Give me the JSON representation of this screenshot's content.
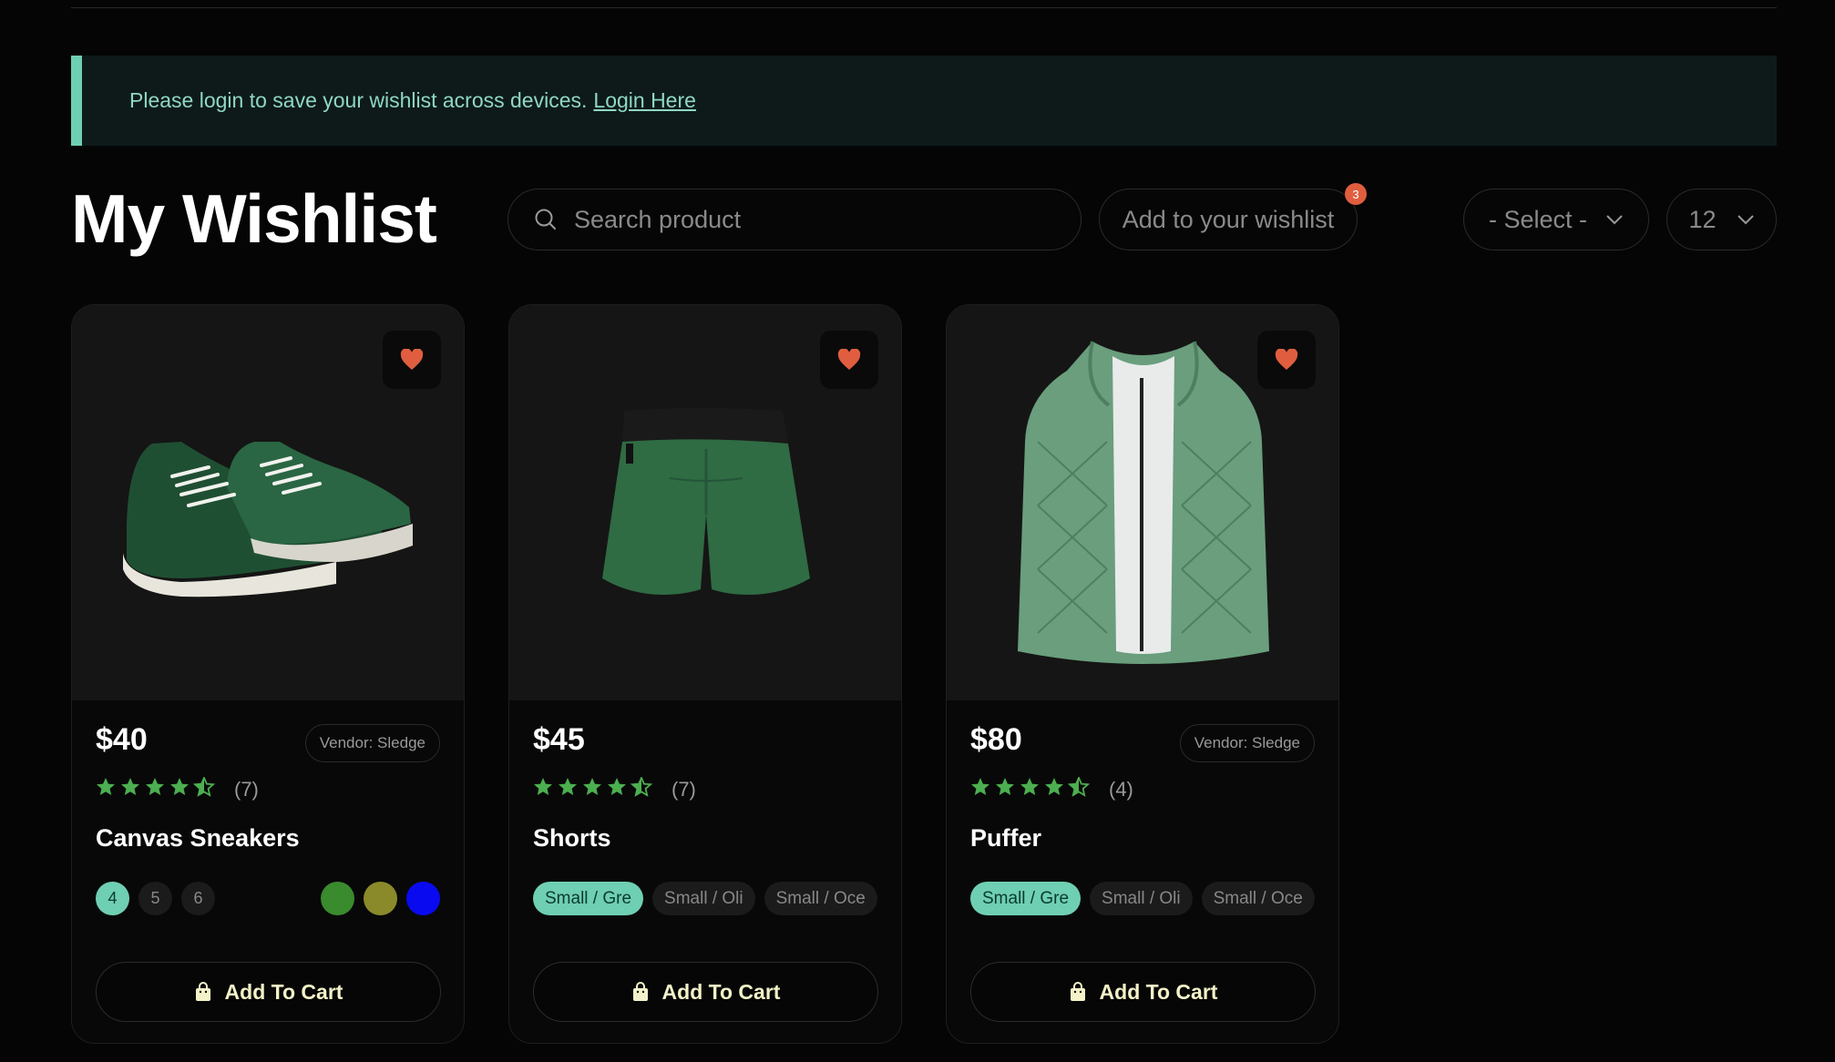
{
  "notice": {
    "text": "Please login to save your wishlist across devices.",
    "link": "Login Here"
  },
  "page_title": "My Wishlist",
  "search": {
    "placeholder": "Search product"
  },
  "add_wishlist": {
    "label": "Add to your wishlist",
    "badge": "3"
  },
  "sort_select": {
    "value": "- Select -"
  },
  "per_page_select": {
    "value": "12"
  },
  "colors": {
    "accent": "#6fcfb2",
    "heart": "#e05e3f",
    "star": "#4caf50",
    "cart_text": "#f4f2c8"
  },
  "products": [
    {
      "price": "$40",
      "vendor": "Vendor: Sledge",
      "rating": 4.5,
      "reviews": "(7)",
      "name": "Canvas Sneakers",
      "sizes": [
        "4",
        "5",
        "6"
      ],
      "active_size": "4",
      "swatches": [
        "#3a8a2e",
        "#8a8a2a",
        "#0a0af0"
      ],
      "cart": "Add To Cart",
      "image": "sneaker-icon"
    },
    {
      "price": "$45",
      "vendor": "",
      "rating": 4.5,
      "reviews": "(7)",
      "name": "Shorts",
      "variants": [
        "Small / Gre",
        "Small / Oli",
        "Small / Oce"
      ],
      "active_variant": "Small / Gre",
      "cart": "Add To Cart",
      "image": "shorts-icon"
    },
    {
      "price": "$80",
      "vendor": "Vendor: Sledge",
      "rating": 4.5,
      "reviews": "(4)",
      "name": "Puffer",
      "variants": [
        "Small / Gre",
        "Small / Oli",
        "Small / Oce"
      ],
      "active_variant": "Small / Gre",
      "cart": "Add To Cart",
      "image": "vest-icon"
    }
  ]
}
